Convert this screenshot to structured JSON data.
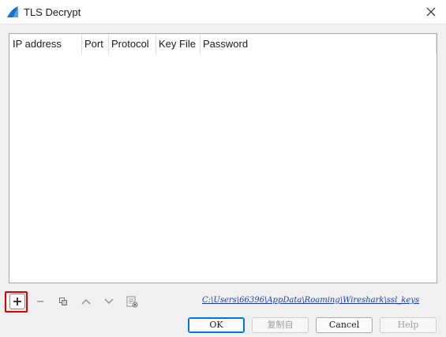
{
  "window": {
    "title": "TLS Decrypt"
  },
  "table": {
    "columns": [
      "IP address",
      "Port",
      "Protocol",
      "Key File",
      "Password"
    ],
    "rows": []
  },
  "toolbar": {
    "buttons": [
      {
        "name": "add",
        "icon": "plus-icon",
        "enabled": true,
        "highlighted": true
      },
      {
        "name": "remove",
        "icon": "minus-icon",
        "enabled": false
      },
      {
        "name": "copy",
        "icon": "copy-icon",
        "enabled": false
      },
      {
        "name": "move-up",
        "icon": "chevron-up-icon",
        "enabled": false
      },
      {
        "name": "move-down",
        "icon": "chevron-down-icon",
        "enabled": false
      },
      {
        "name": "clear",
        "icon": "clear-list-icon",
        "enabled": false
      }
    ]
  },
  "file_path": "C:\\Users\\66396\\AppData\\Roaming\\Wireshark\\ssl_keys",
  "buttons": {
    "ok": "OK",
    "copy_from": "复制自",
    "cancel": "Cancel",
    "help": "Help"
  },
  "colors": {
    "highlight": "#e00000",
    "link": "#1a3ab8",
    "accent": "#0078d4"
  }
}
